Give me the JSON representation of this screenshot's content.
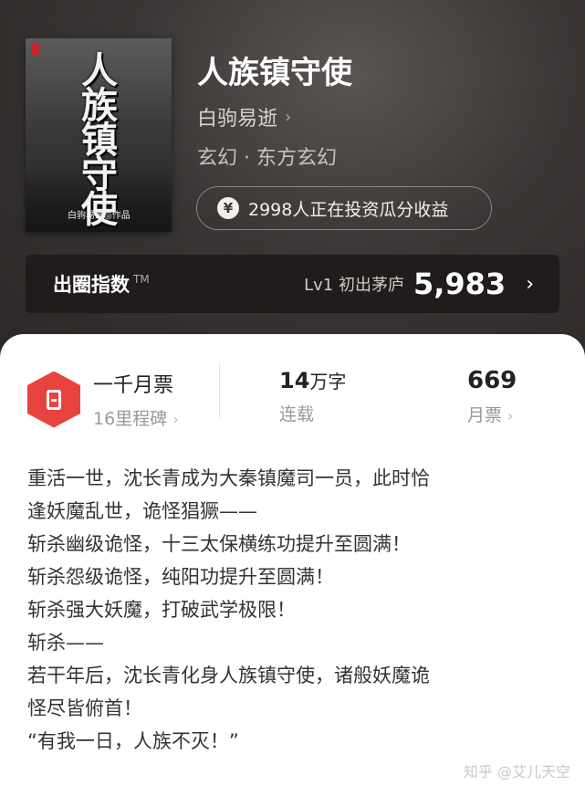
{
  "book": {
    "cover_title": "人族镇守使",
    "cover_author": "白驹易逝◎作品",
    "title": "人族镇守使",
    "author": "白驹易逝",
    "genre": "玄幻 · 东方玄幻",
    "investors": "2998人正在投资瓜分收益"
  },
  "index_bar": {
    "label": "出圈指数",
    "tm": "TM",
    "level": "Lv1 初出茅庐",
    "score": "5,983"
  },
  "stats": {
    "milestone_title": "一千月票",
    "milestone_sub": "16里程碑",
    "words_num": "14",
    "words_unit": "万字",
    "words_status": "连载",
    "tickets_num": "669",
    "tickets_label": "月票"
  },
  "synopsis": [
    "重活一世，沈长青成为大秦镇魔司一员，此时恰",
    "逢妖魔乱世，诡怪猖獗——",
    "斩杀幽级诡怪，十三太保横练功提升至圆满！",
    "斩杀怨级诡怪，纯阳功提升至圆满！",
    "斩杀强大妖魔，打破武学极限！",
    "斩杀——",
    "若干年后，沈长青化身人族镇守使，诸般妖魔诡",
    "怪尽皆俯首！",
    "“有我一日，人族不灭！”"
  ],
  "watermark": "知乎 @艾儿天空",
  "icons": {
    "yen": "¥",
    "chevron": "›"
  },
  "colors": {
    "accent_red": "#e9433f",
    "hero_bg": "#3a3635",
    "index_bar_bg": "#1f1c1b"
  }
}
